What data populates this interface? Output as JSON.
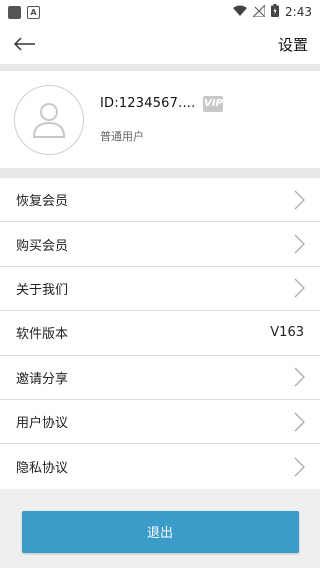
{
  "status_bar": {
    "time": "2:43"
  },
  "header": {
    "title": "设置"
  },
  "profile": {
    "id": "ID:1234567....",
    "vip_badge": "VIP",
    "level": "普通用户"
  },
  "menu": [
    {
      "label": "恢复会员"
    },
    {
      "label": "购买会员"
    },
    {
      "label": "关于我们"
    },
    {
      "label": "软件版本",
      "value": "V163"
    },
    {
      "label": "邀请分享"
    },
    {
      "label": "用户协议"
    },
    {
      "label": "隐私协议"
    }
  ],
  "logout_label": "退出",
  "colors": {
    "accent": "#3b9bc9",
    "background": "#efefef"
  }
}
